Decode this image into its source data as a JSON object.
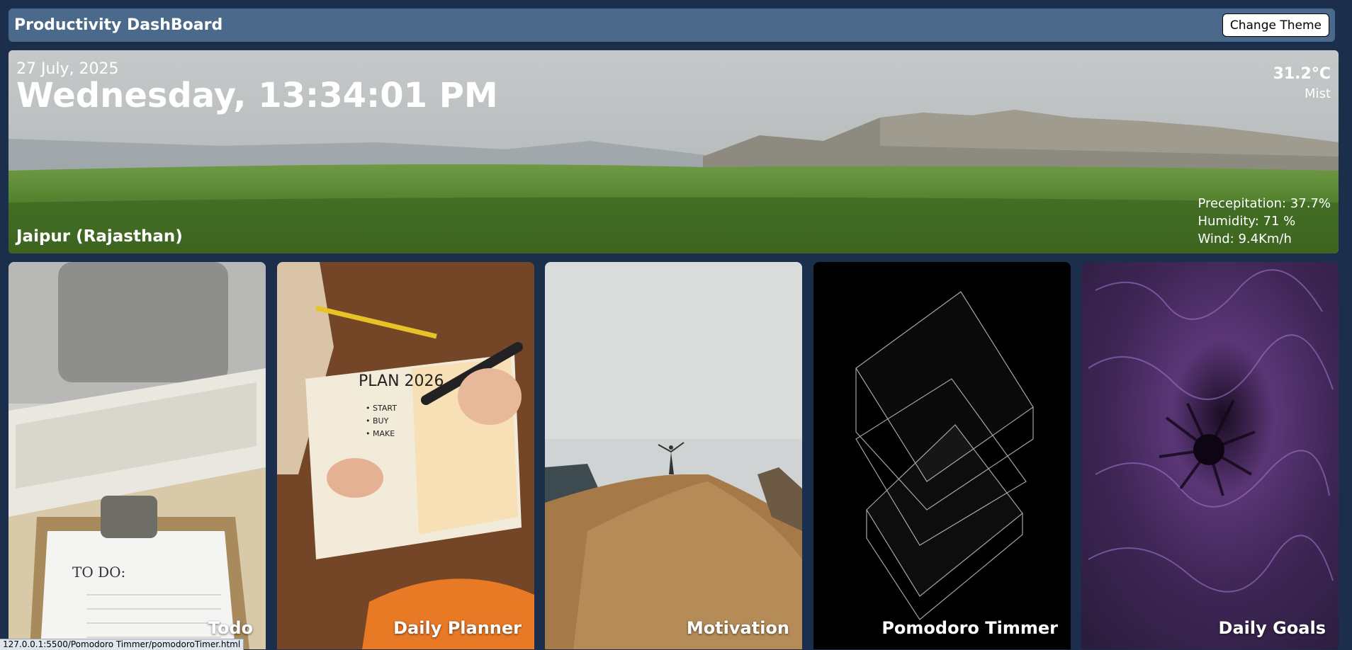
{
  "header": {
    "title": "Productivity DashBoard",
    "theme_button": "Change Theme"
  },
  "hero": {
    "date": "27 July, 2025",
    "day_time": "Wednesday, 13:34:01 PM",
    "temperature": "31.2°C",
    "condition": "Mist",
    "location": "Jaipur (Rajasthan)",
    "precipitation": "Precepitation: 37.7%",
    "humidity": "Humidity: 71 %",
    "wind": "Wind: 9.4Km/h"
  },
  "cards": [
    {
      "label": "Todo"
    },
    {
      "label": "Daily Planner"
    },
    {
      "label": "Motivation"
    },
    {
      "label": "Pomodoro Timmer"
    },
    {
      "label": "Daily Goals"
    }
  ],
  "status_bar": {
    "url": "127.0.0.1:5500/Pomodoro Timmer/pomodoroTimer.html"
  }
}
